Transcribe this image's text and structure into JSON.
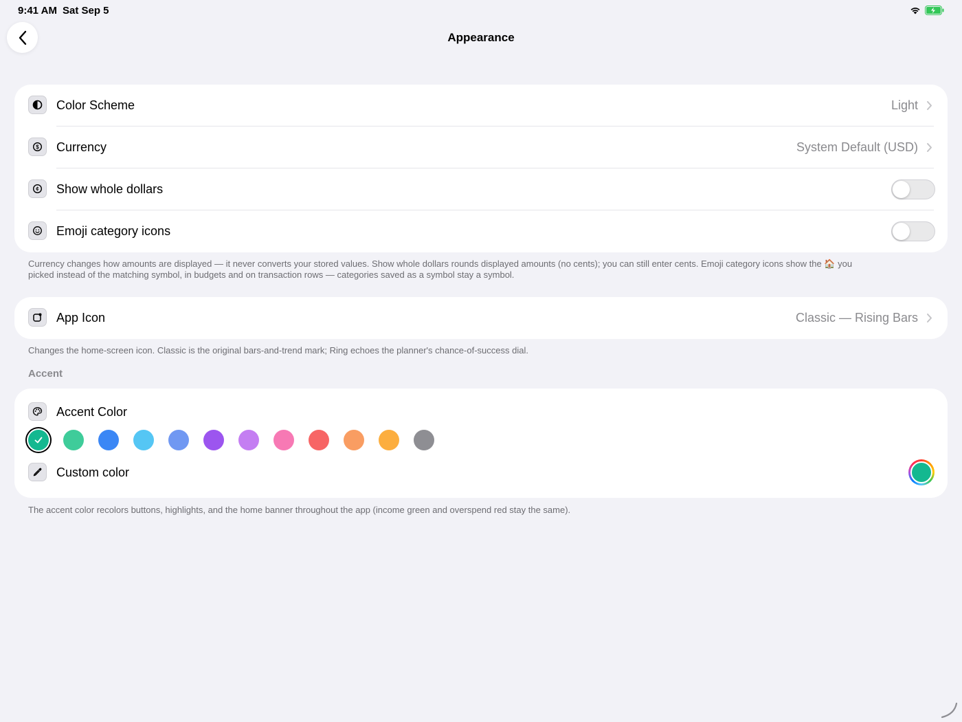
{
  "status_bar": {
    "time": "9:41 AM",
    "date": "Sat Sep 5"
  },
  "nav": {
    "title": "Appearance",
    "back_icon": "chevron-left-icon"
  },
  "display_group": {
    "rows": [
      {
        "label": "Color Scheme",
        "value": "Light",
        "icon": "half-circle-icon",
        "control": "chevron"
      },
      {
        "label": "Currency",
        "value": "System Default (USD)",
        "icon": "dollar-circle-icon",
        "control": "chevron"
      },
      {
        "label": "Show whole dollars",
        "icon": "cents-circle-icon",
        "control": "toggle",
        "on": false
      },
      {
        "label": "Emoji category icons",
        "icon": "smiley-icon",
        "control": "toggle",
        "on": false
      }
    ],
    "footer_line1": "Currency changes how amounts are displayed — it never converts your stored values. Show whole dollars rounds displayed amounts (no cents); you can still enter cents. Emoji category icons show the",
    "footer_emoji": "🏠",
    "footer_line1_end": "you",
    "footer_line2": "picked instead of the matching symbol, in budgets and on transaction rows — categories saved as a symbol stay a symbol."
  },
  "app_icon_group": {
    "label": "App Icon",
    "value": "Classic — Rising Bars",
    "icon": "app-icon-icon",
    "footer": "Changes the home-screen icon. Classic is the original bars-and-trend mark; Ring echoes the planner's chance-of-success dial."
  },
  "accent": {
    "section_header": "Accent",
    "label": "Accent Color",
    "icon": "palette-icon",
    "swatches": [
      {
        "name": "teal",
        "color": "#14b890",
        "selected": true
      },
      {
        "name": "green",
        "color": "#3fcc9a"
      },
      {
        "name": "blue",
        "color": "#3b87f5"
      },
      {
        "name": "sky",
        "color": "#55c6f4"
      },
      {
        "name": "periwinkle",
        "color": "#7098f2"
      },
      {
        "name": "purple",
        "color": "#9c55ef"
      },
      {
        "name": "lavender",
        "color": "#c47ef2"
      },
      {
        "name": "pink",
        "color": "#f779b4"
      },
      {
        "name": "red",
        "color": "#f76565"
      },
      {
        "name": "orange",
        "color": "#f99d62"
      },
      {
        "name": "amber",
        "color": "#fcae3f"
      },
      {
        "name": "gray",
        "color": "#8e8e93"
      }
    ],
    "custom_label": "Custom color",
    "custom_icon": "eyedropper-icon",
    "custom_color": "#14b890",
    "footer": "The accent color recolors buttons, highlights, and the home banner throughout the app (income green and overspend red stay the same)."
  }
}
